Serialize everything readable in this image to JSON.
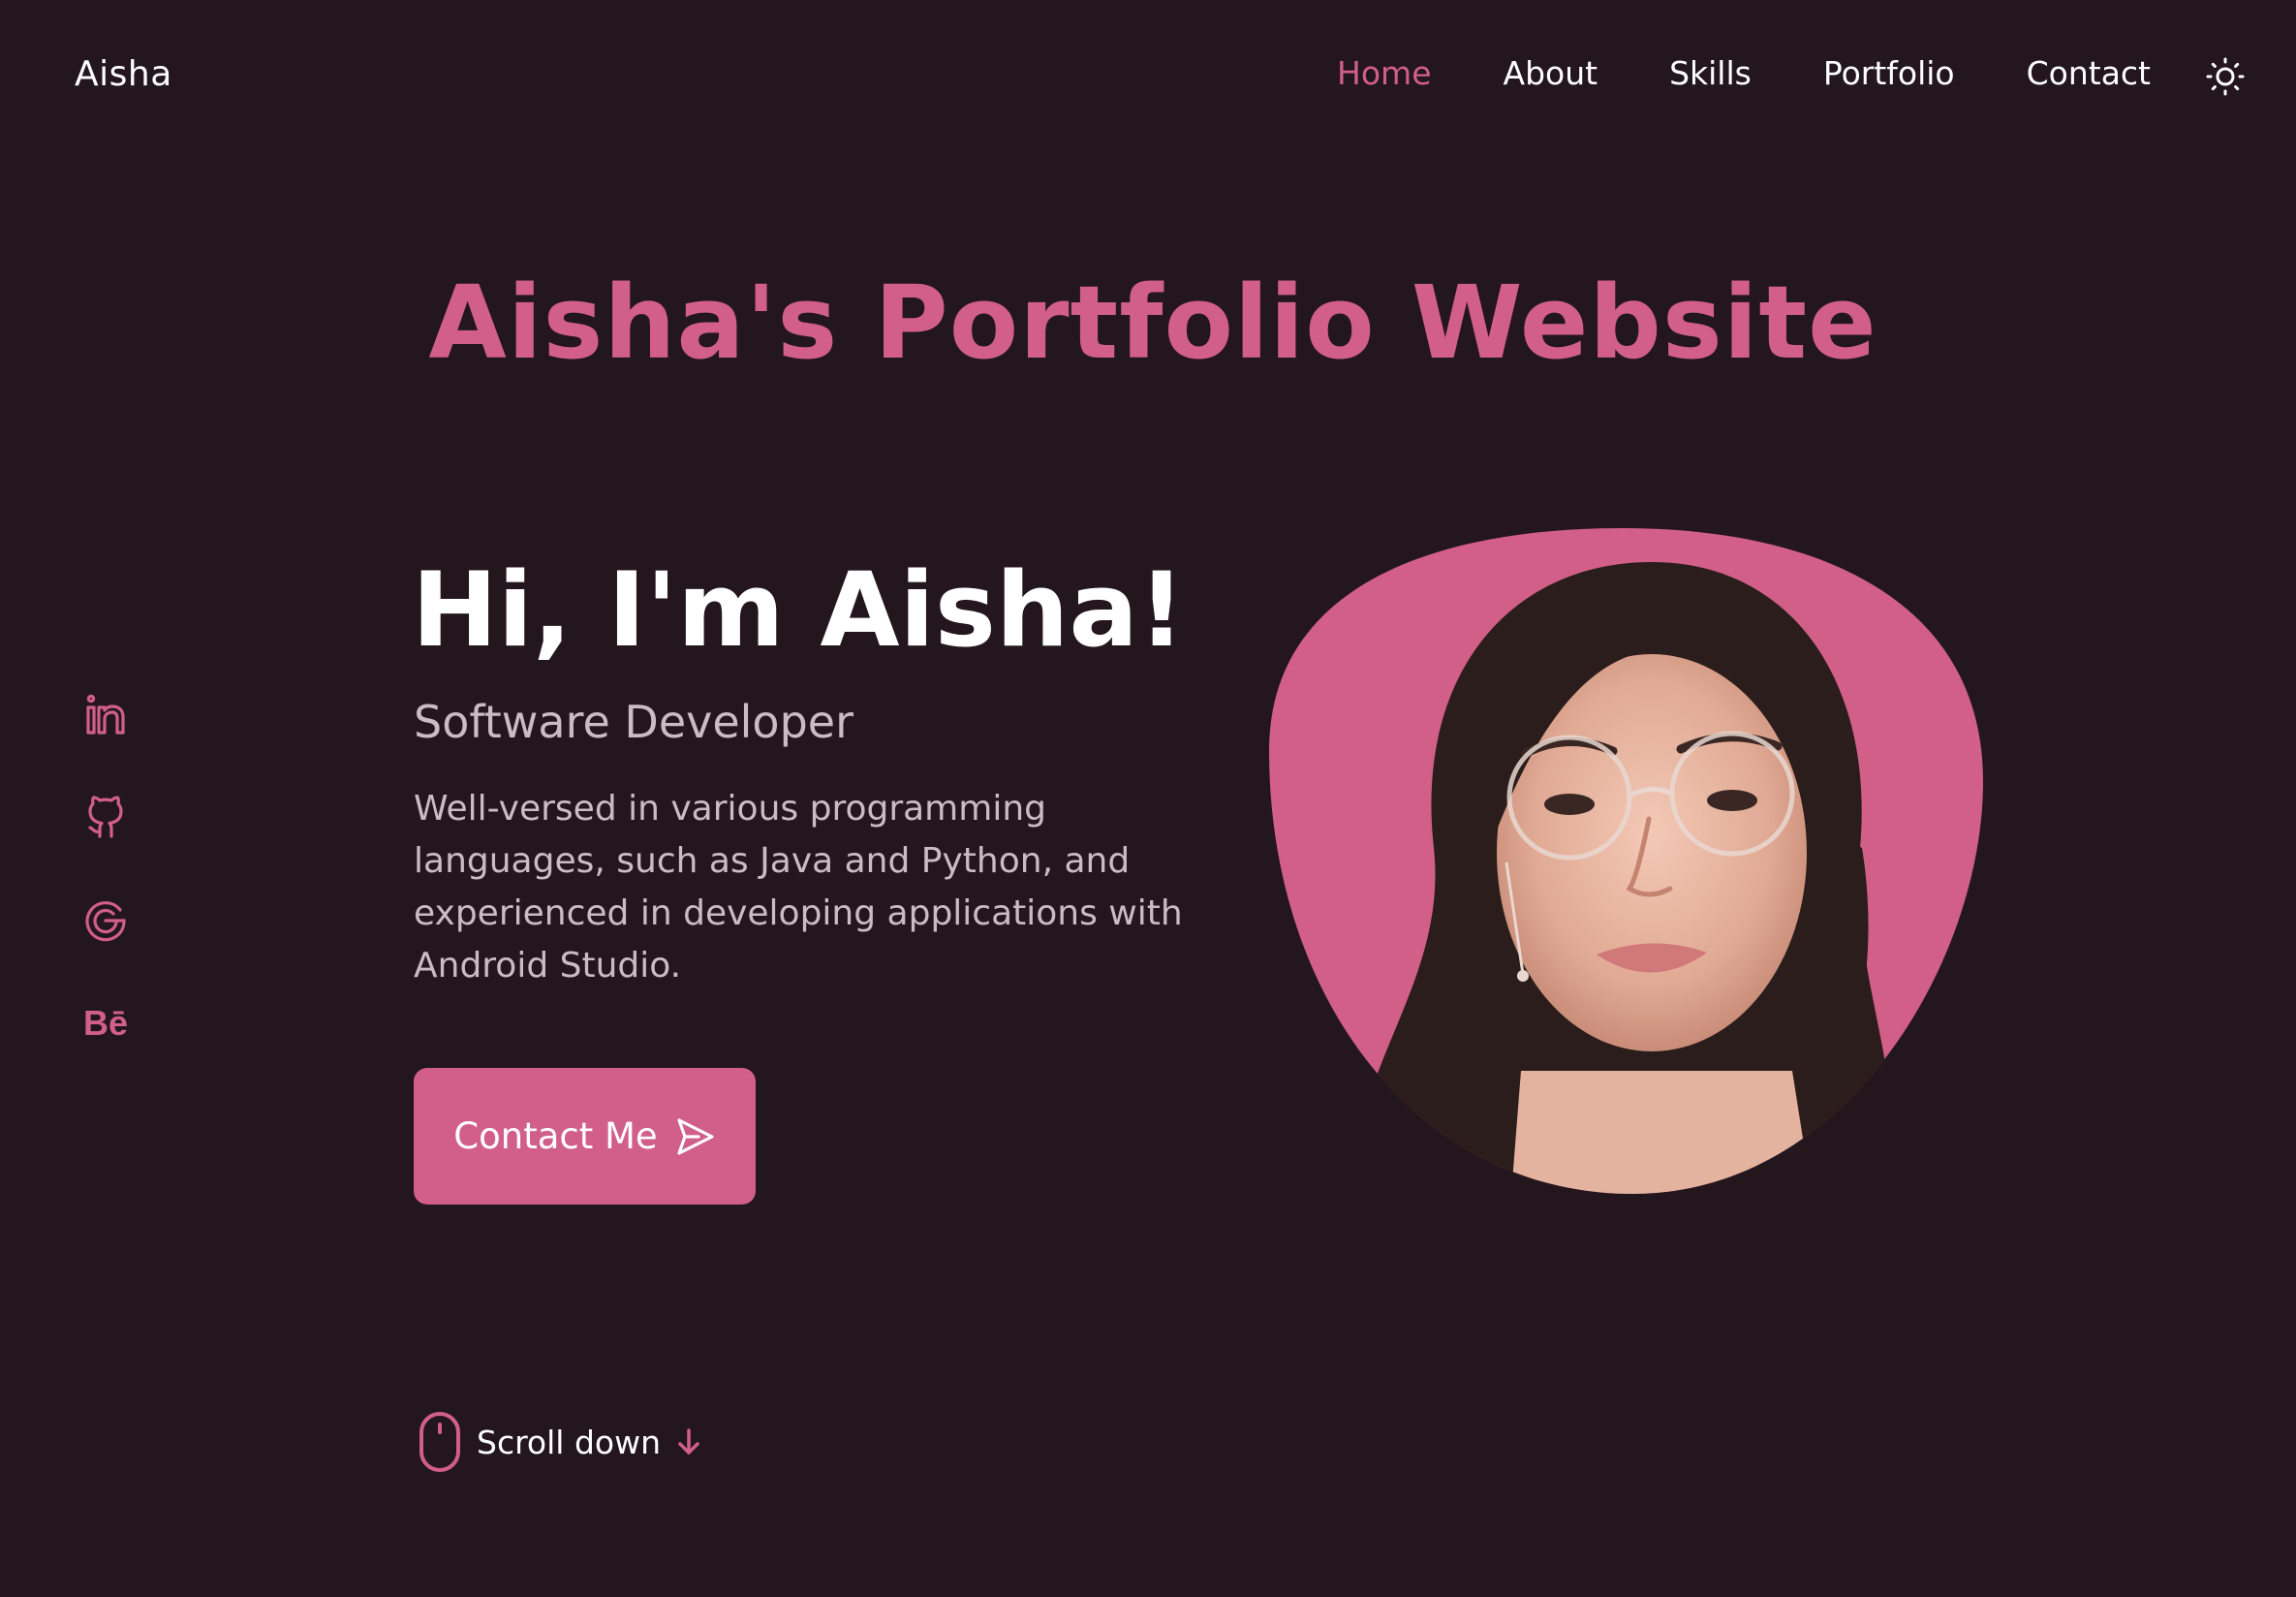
{
  "header": {
    "logo": "Aisha",
    "nav": [
      {
        "label": "Home",
        "active": true
      },
      {
        "label": "About",
        "active": false
      },
      {
        "label": "Skills",
        "active": false
      },
      {
        "label": "Portfolio",
        "active": false
      },
      {
        "label": "Contact",
        "active": false
      }
    ],
    "theme_icon": "sun-icon"
  },
  "hero": {
    "site_title": "Aisha's Portfolio Website",
    "greeting": "Hi, I'm Aisha!",
    "role": "Software Developer",
    "bio": "Well-versed in various programming languages, such as Java and Python, and experienced in developing applications with Android Studio.",
    "cta_label": "Contact Me",
    "cta_icon": "send-icon"
  },
  "social": {
    "icons": [
      "linkedin-icon",
      "github-icon",
      "google-icon",
      "behance-icon"
    ],
    "behance_text": "Bē"
  },
  "scroll": {
    "label": "Scroll down",
    "icons": [
      "mouse-icon",
      "arrow-down-icon"
    ]
  },
  "colors": {
    "background": "#24161d",
    "accent": "#d15f88",
    "text": "#ffffff",
    "muted_text": "#c9bcc2"
  }
}
